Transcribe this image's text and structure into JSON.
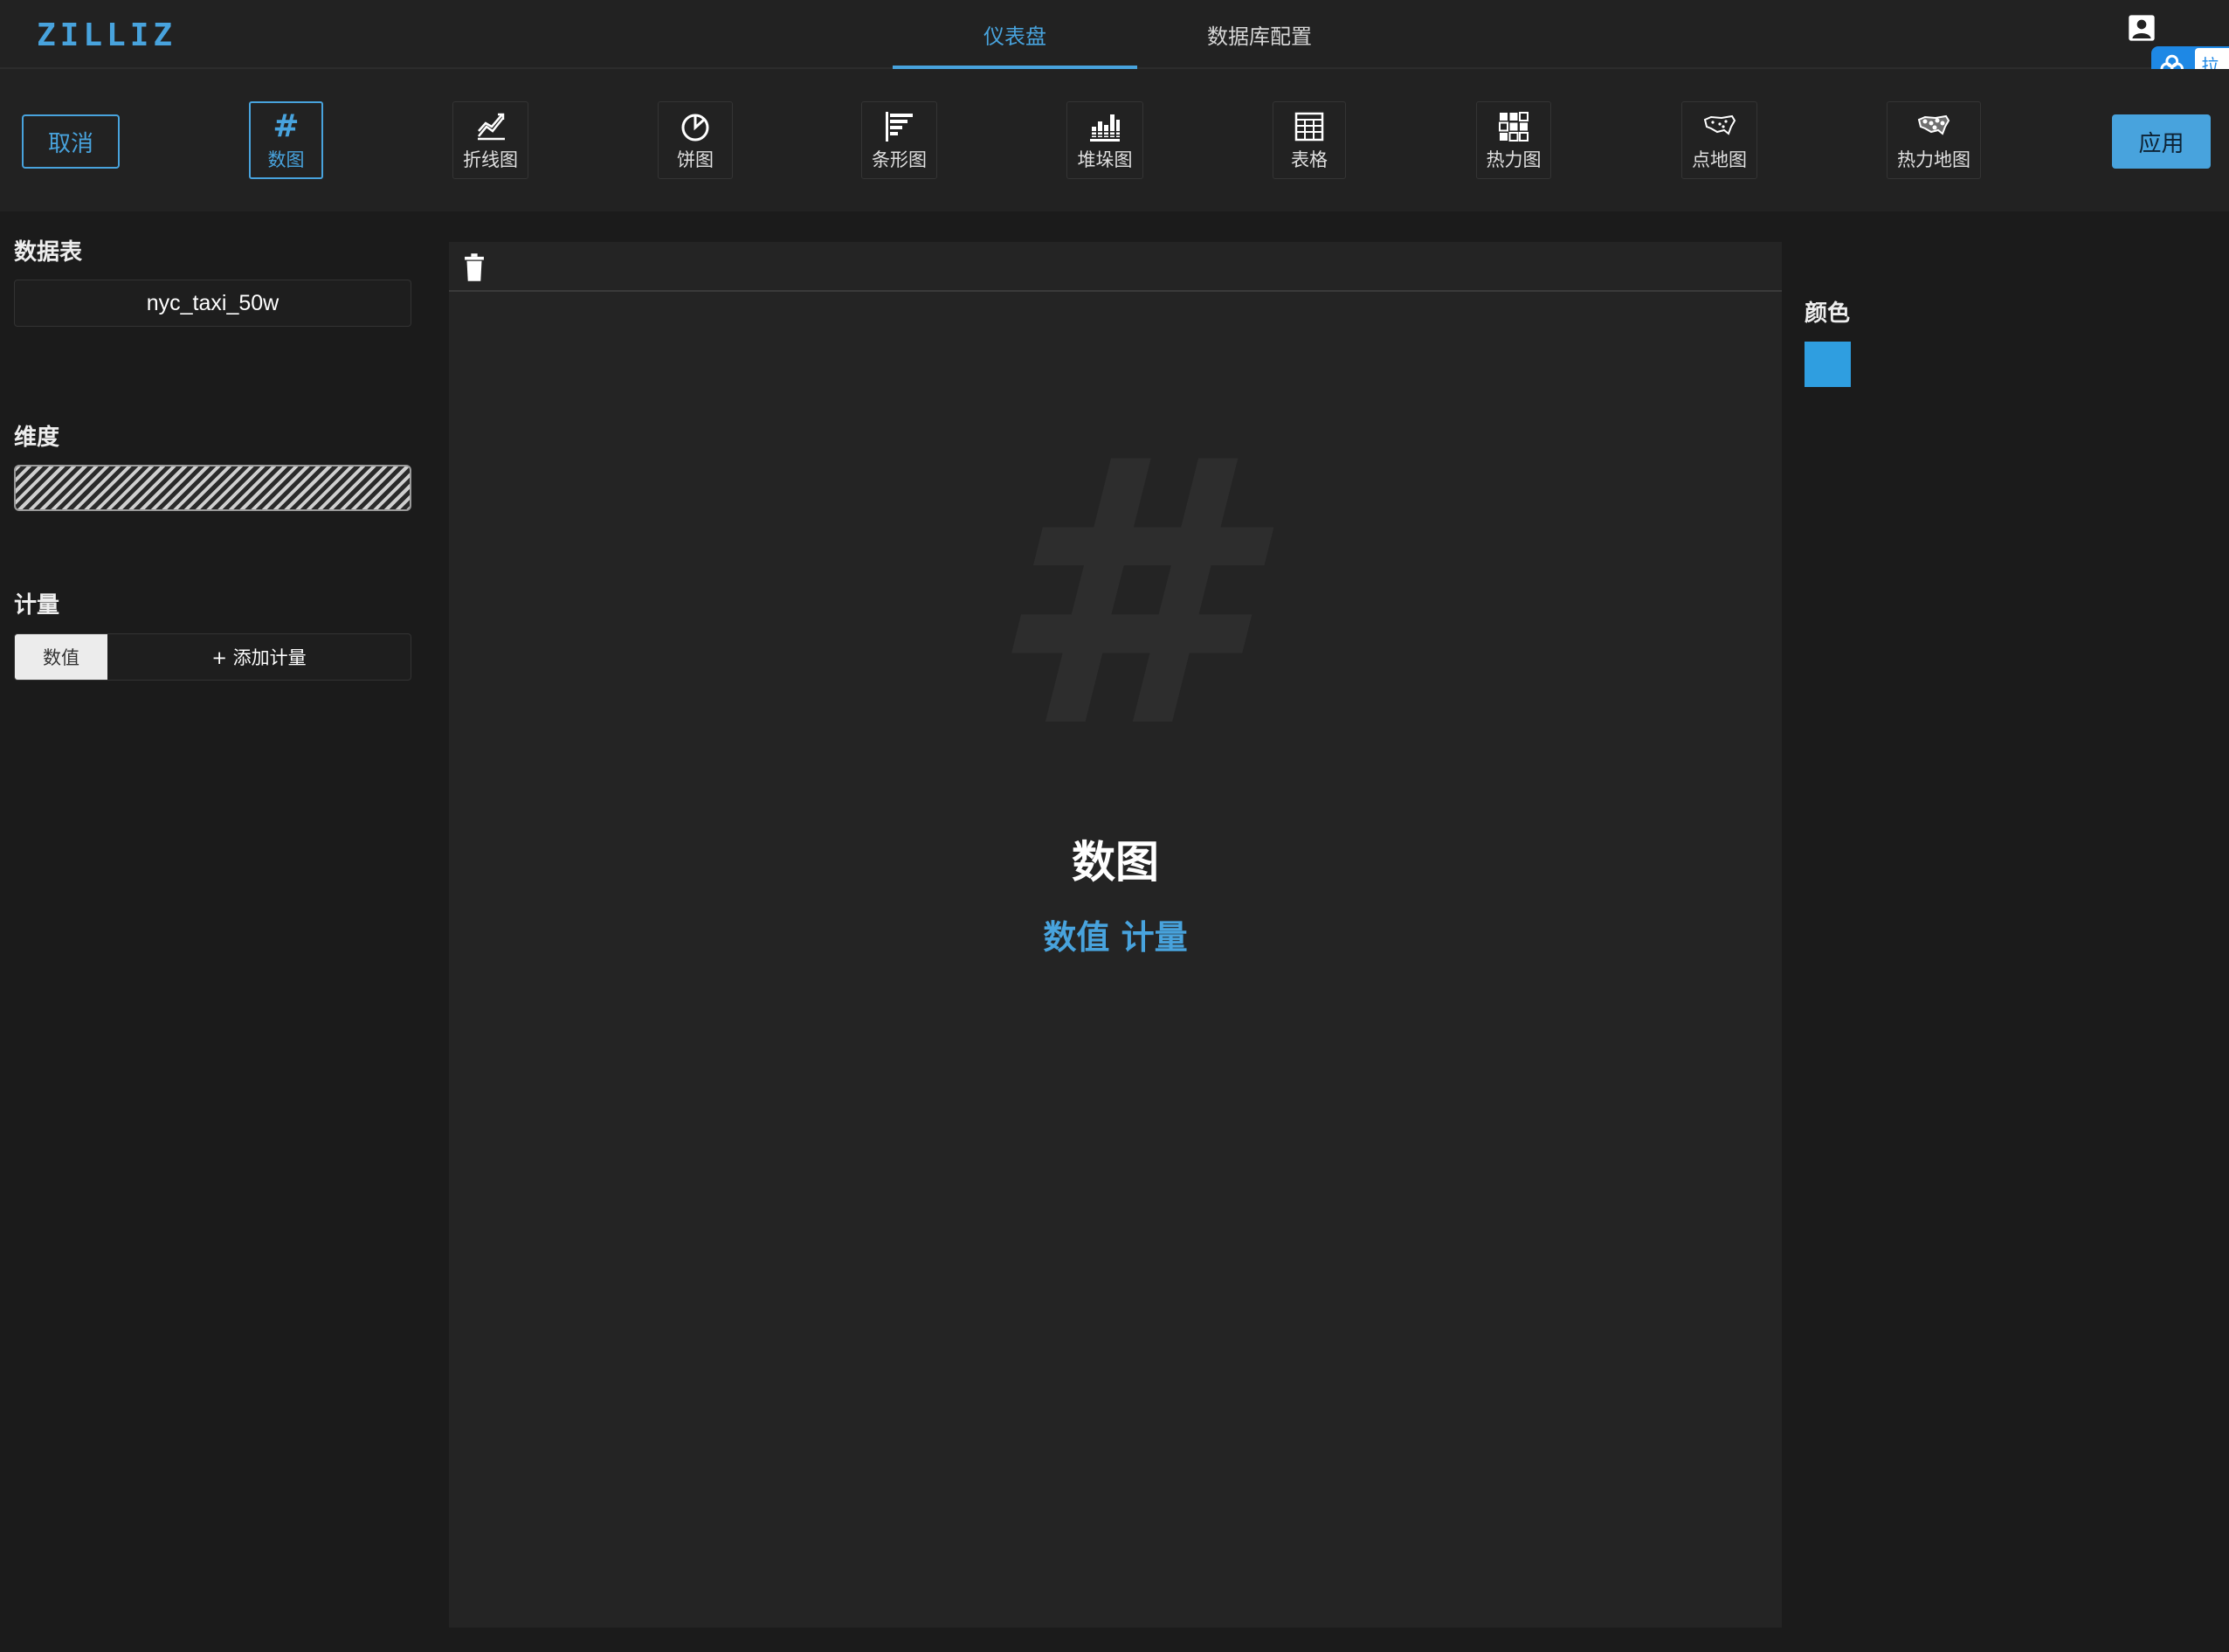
{
  "app": {
    "logo": "ZILLIZ",
    "tabs": [
      {
        "label": "仪表盘",
        "active": true
      },
      {
        "label": "数据库配置",
        "active": false
      }
    ],
    "float_widget_text": "拉"
  },
  "toolbar": {
    "cancel_label": "取消",
    "apply_label": "应用",
    "chart_types": [
      {
        "label": "数图",
        "icon": "hash-icon",
        "selected": true
      },
      {
        "label": "折线图",
        "icon": "line-chart-icon"
      },
      {
        "label": "饼图",
        "icon": "pie-chart-icon"
      },
      {
        "label": "条形图",
        "icon": "bar-chart-icon"
      },
      {
        "label": "堆垛图",
        "icon": "stacked-chart-icon"
      },
      {
        "label": "表格",
        "icon": "table-icon"
      },
      {
        "label": "热力图",
        "icon": "heatmap-icon"
      },
      {
        "label": "点地图",
        "icon": "point-map-icon"
      },
      {
        "label": "热力地图",
        "icon": "heat-map-icon"
      }
    ]
  },
  "left_panel": {
    "table_label": "数据表",
    "table_value": "nyc_taxi_50w",
    "dimension_label": "维度",
    "measure_label": "计量",
    "measure_tag": "数值",
    "add_measure": "+ 添加计量"
  },
  "canvas": {
    "placeholder_glyph": "#",
    "title": "数图",
    "subtitle": "数值 计量"
  },
  "right_panel": {
    "color_label": "颜色",
    "color_value": "#2f9ee0"
  },
  "colors": {
    "accent": "#48a3dd",
    "background": "#1b1b1b",
    "panel": "#222222"
  }
}
